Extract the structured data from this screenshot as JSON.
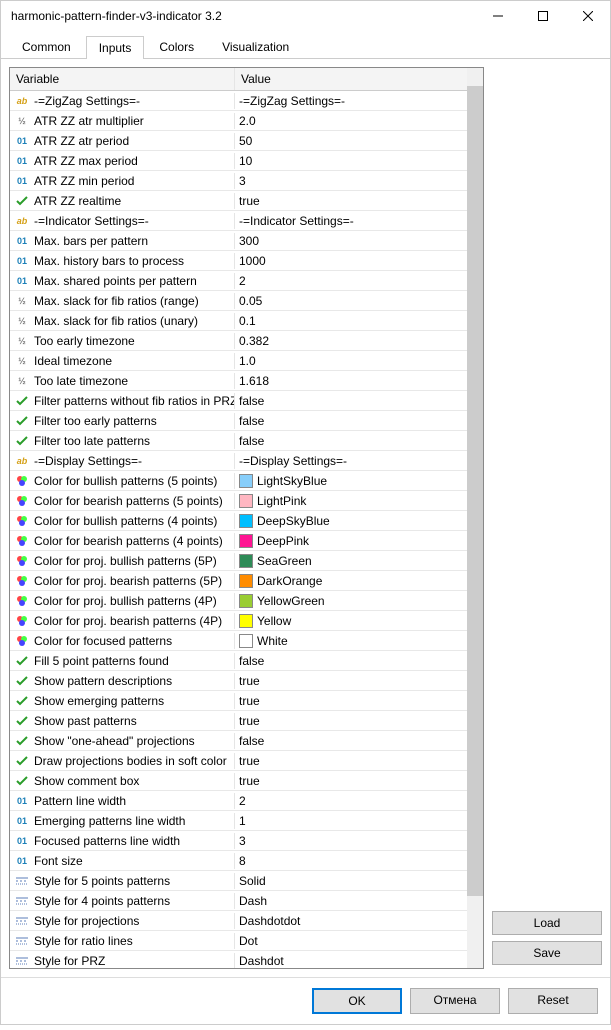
{
  "title": "harmonic-pattern-finder-v3-indicator 3.2",
  "tabs": {
    "common": "Common",
    "inputs": "Inputs",
    "colors": "Colors",
    "visualization": "Visualization"
  },
  "headers": {
    "variable": "Variable",
    "value": "Value"
  },
  "buttons": {
    "load": "Load",
    "save": "Save",
    "ok": "OK",
    "cancel": "Отмена",
    "reset": "Reset"
  },
  "rows": [
    {
      "type": "ab",
      "name": "-=ZigZag Settings=-",
      "value": "-=ZigZag Settings=-"
    },
    {
      "type": "half",
      "name": "ATR ZZ atr multiplier",
      "value": "2.0"
    },
    {
      "type": "01",
      "name": "ATR ZZ atr period",
      "value": "50"
    },
    {
      "type": "01",
      "name": "ATR ZZ max period",
      "value": "10"
    },
    {
      "type": "01",
      "name": "ATR ZZ min period",
      "value": "3"
    },
    {
      "type": "bool",
      "name": "ATR ZZ realtime",
      "value": "true"
    },
    {
      "type": "ab",
      "name": "-=Indicator Settings=-",
      "value": "-=Indicator Settings=-"
    },
    {
      "type": "01",
      "name": "Max. bars per pattern",
      "value": "300"
    },
    {
      "type": "01",
      "name": "Max. history bars to process",
      "value": "1000"
    },
    {
      "type": "01",
      "name": "Max. shared points per pattern",
      "value": "2"
    },
    {
      "type": "half",
      "name": "Max. slack for fib ratios (range)",
      "value": "0.05"
    },
    {
      "type": "half",
      "name": "Max. slack for fib ratios (unary)",
      "value": "0.1"
    },
    {
      "type": "half",
      "name": "Too early timezone",
      "value": "0.382"
    },
    {
      "type": "half",
      "name": "Ideal timezone",
      "value": "1.0"
    },
    {
      "type": "half",
      "name": "Too late timezone",
      "value": "1.618"
    },
    {
      "type": "bool",
      "name": "Filter patterns without fib ratios in PRZ",
      "value": "false"
    },
    {
      "type": "bool",
      "name": "Filter too early patterns",
      "value": "false"
    },
    {
      "type": "bool",
      "name": "Filter too late patterns",
      "value": "false"
    },
    {
      "type": "ab",
      "name": "-=Display Settings=-",
      "value": "-=Display Settings=-"
    },
    {
      "type": "color",
      "name": "Color for bullish patterns (5 points)",
      "value": "LightSkyBlue",
      "hex": "#87CEFA"
    },
    {
      "type": "color",
      "name": "Color for bearish patterns (5 points)",
      "value": "LightPink",
      "hex": "#FFB6C1"
    },
    {
      "type": "color",
      "name": "Color for bullish patterns (4 points)",
      "value": "DeepSkyBlue",
      "hex": "#00BFFF"
    },
    {
      "type": "color",
      "name": "Color for bearish patterns (4 points)",
      "value": "DeepPink",
      "hex": "#FF1493"
    },
    {
      "type": "color",
      "name": "Color for proj. bullish patterns (5P)",
      "value": "SeaGreen",
      "hex": "#2E8B57"
    },
    {
      "type": "color",
      "name": "Color for proj. bearish patterns (5P)",
      "value": "DarkOrange",
      "hex": "#FF8C00"
    },
    {
      "type": "color",
      "name": "Color for proj. bullish patterns (4P)",
      "value": "YellowGreen",
      "hex": "#9ACD32"
    },
    {
      "type": "color",
      "name": "Color for proj. bearish patterns (4P)",
      "value": "Yellow",
      "hex": "#FFFF00"
    },
    {
      "type": "color",
      "name": "Color for focused patterns",
      "value": "White",
      "hex": "#FFFFFF"
    },
    {
      "type": "bool",
      "name": "Fill 5 point patterns found",
      "value": "false"
    },
    {
      "type": "bool",
      "name": "Show pattern descriptions",
      "value": "true"
    },
    {
      "type": "bool",
      "name": "Show emerging patterns",
      "value": "true"
    },
    {
      "type": "bool",
      "name": "Show past patterns",
      "value": "true"
    },
    {
      "type": "bool",
      "name": "Show \"one-ahead\" projections",
      "value": "false"
    },
    {
      "type": "bool",
      "name": "Draw projections bodies in soft color",
      "value": "true"
    },
    {
      "type": "bool",
      "name": "Show comment box",
      "value": "true"
    },
    {
      "type": "01",
      "name": "Pattern line width",
      "value": "2"
    },
    {
      "type": "01",
      "name": "Emerging patterns line width",
      "value": "1"
    },
    {
      "type": "01",
      "name": "Focused patterns line width",
      "value": "3"
    },
    {
      "type": "01",
      "name": "Font size",
      "value": "8"
    },
    {
      "type": "style",
      "name": "Style for 5 points patterns",
      "value": "Solid"
    },
    {
      "type": "style",
      "name": "Style for 4 points patterns",
      "value": "Dash"
    },
    {
      "type": "style",
      "name": "Style for projections",
      "value": "Dashdotdot"
    },
    {
      "type": "style",
      "name": "Style for ratio lines",
      "value": "Dot"
    },
    {
      "type": "style",
      "name": "Style for PRZ",
      "value": "Dashdot"
    }
  ]
}
